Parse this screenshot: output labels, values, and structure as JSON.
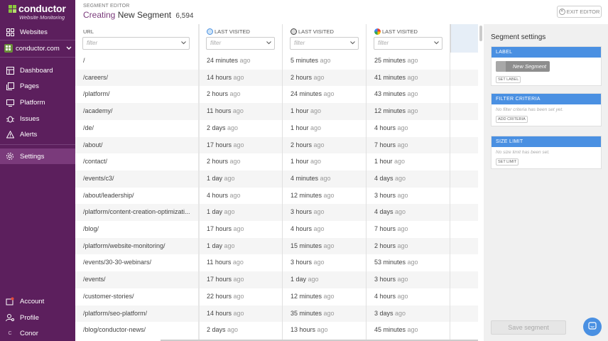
{
  "brand": {
    "name": "conductor",
    "subtitle": "Website Monitoring"
  },
  "sidebar": {
    "websites": "Websites",
    "domain": "conductor.com",
    "items": [
      {
        "label": "Dashboard",
        "icon": "dashboard-icon"
      },
      {
        "label": "Pages",
        "icon": "pages-icon"
      },
      {
        "label": "Platform",
        "icon": "platform-icon"
      },
      {
        "label": "Issues",
        "icon": "bug-icon"
      },
      {
        "label": "Alerts",
        "icon": "warning-icon"
      },
      {
        "label": "Settings",
        "icon": "gear-icon",
        "active": true
      }
    ],
    "bottom": [
      {
        "label": "Account",
        "icon": "account-icon"
      },
      {
        "label": "Profile",
        "icon": "profile-icon"
      },
      {
        "label": "Conor",
        "icon": "user-initial"
      }
    ],
    "user_initial": "C"
  },
  "header": {
    "section": "SEGMENT EDITOR",
    "creating": "Creating",
    "segment_name": "New Segment",
    "count": "6,594",
    "exit_label": "EXIT EDITOR"
  },
  "table": {
    "columns": [
      "URL",
      "LAST VISITED",
      "LAST VISITED",
      "LAST VISITED"
    ],
    "filter_placeholder": "filter",
    "ago": "ago",
    "rows": [
      [
        "/",
        "24 minutes",
        "5 minutes",
        "25 minutes"
      ],
      [
        "/careers/",
        "14 hours",
        "2 hours",
        "41 minutes"
      ],
      [
        "/platform/",
        "2 hours",
        "24 minutes",
        "43 minutes"
      ],
      [
        "/academy/",
        "11 hours",
        "1 hour",
        "12 minutes"
      ],
      [
        "/de/",
        "2 days",
        "1 hour",
        "4 hours"
      ],
      [
        "/about/",
        "17 hours",
        "2 hours",
        "7 hours"
      ],
      [
        "/contact/",
        "2 hours",
        "1 hour",
        "1 hour"
      ],
      [
        "/events/c3/",
        "1 day",
        "4 minutes",
        "4 days"
      ],
      [
        "/about/leadership/",
        "4 hours",
        "12 minutes",
        "3 hours"
      ],
      [
        "/platform/content-creation-optimizati...",
        "1 day",
        "3 hours",
        "4 days"
      ],
      [
        "/blog/",
        "17 hours",
        "4 hours",
        "7 hours"
      ],
      [
        "/platform/website-monitoring/",
        "1 day",
        "15 minutes",
        "2 hours"
      ],
      [
        "/events/30-30-webinars/",
        "11 hours",
        "3 hours",
        "53 minutes"
      ],
      [
        "/events/",
        "17 hours",
        "1 day",
        "3 hours"
      ],
      [
        "/customer-stories/",
        "22 hours",
        "12 minutes",
        "4 hours"
      ],
      [
        "/platform/seo-platform/",
        "14 hours",
        "35 minutes",
        "3 days"
      ],
      [
        "/blog/conductor-news/",
        "2 days",
        "13 hours",
        "45 minutes"
      ]
    ]
  },
  "panel": {
    "title": "Segment settings",
    "label_head": "LABEL",
    "label_value": "New Segment",
    "set_label": "SET LABEL",
    "filter_head": "FILTER CRITERIA",
    "filter_note": "No filter criteria has been set yet.",
    "add_criteria": "ADD CRITERIA",
    "size_head": "SIZE LIMIT",
    "size_note": "No size limit has been set.",
    "set_limit": "SET LIMIT",
    "save": "Save segment"
  },
  "colors": {
    "sidebar": "#5c1f5d",
    "accent": "#4a90e2",
    "brand_green": "#8cc63f"
  }
}
